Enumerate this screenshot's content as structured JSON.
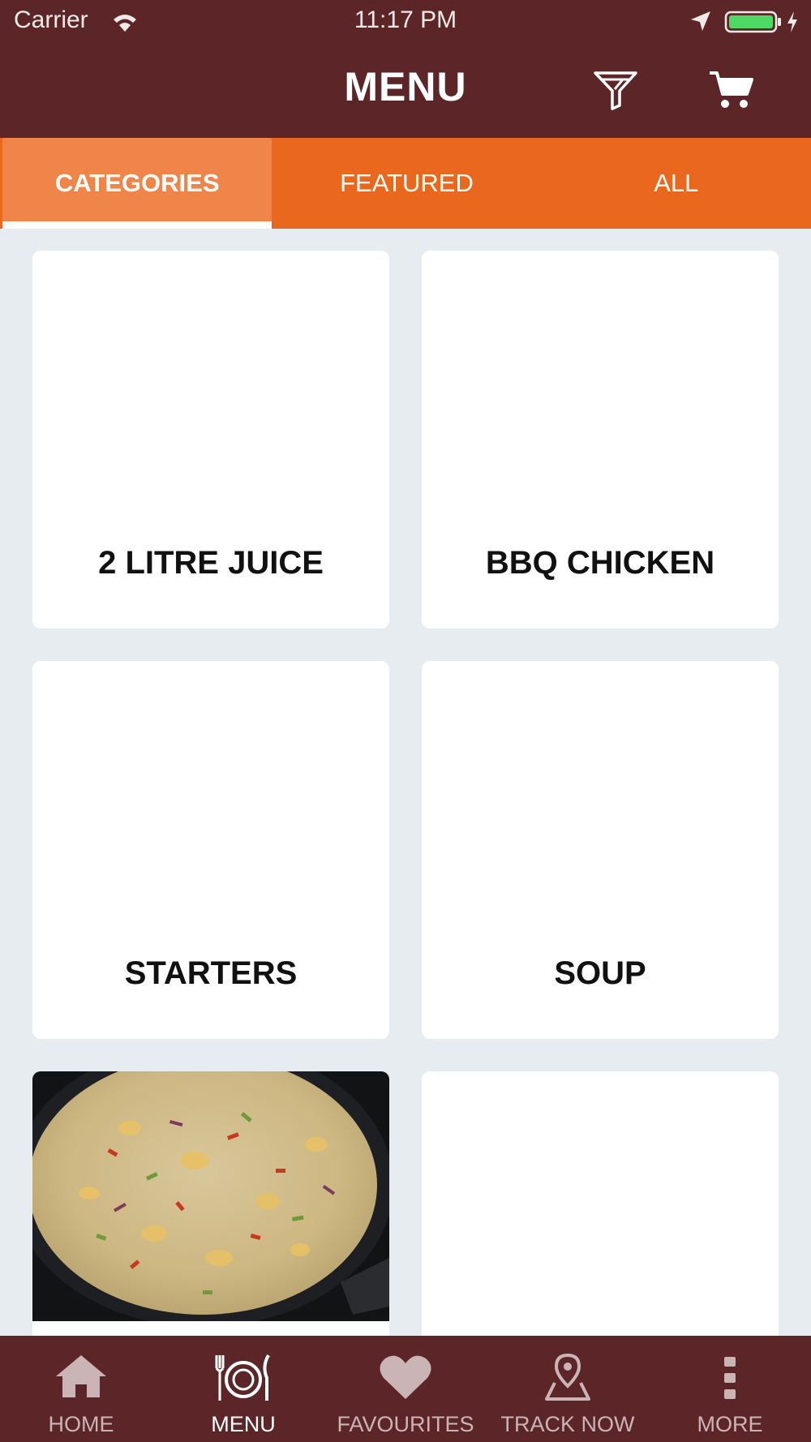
{
  "status_bar": {
    "carrier": "Carrier",
    "time": "11:17 PM"
  },
  "header": {
    "title": "MENU",
    "filter_icon": "filter-icon",
    "cart_icon": "cart-icon"
  },
  "tabs": [
    {
      "label": "CATEGORIES",
      "active": true
    },
    {
      "label": "FEATURED",
      "active": false
    },
    {
      "label": "ALL",
      "active": false
    }
  ],
  "categories": [
    {
      "name": "2 LITRE JUICE"
    },
    {
      "name": "BBQ CHICKEN"
    },
    {
      "name": "STARTERS"
    },
    {
      "name": "SOUP"
    },
    {
      "name": "",
      "image": "fried-rice-photo"
    },
    {
      "name": ""
    }
  ],
  "bottom_nav": [
    {
      "label": "HOME",
      "icon": "home-icon"
    },
    {
      "label": "MENU",
      "icon": "plate-cutlery-icon",
      "active": true
    },
    {
      "label": "FAVOURITES",
      "icon": "heart-icon"
    },
    {
      "label": "TRACK NOW",
      "icon": "map-pin-icon"
    },
    {
      "label": "MORE",
      "icon": "more-vertical-icon"
    }
  ],
  "colors": {
    "header_bg": "#5c2629",
    "tab_bar": "#ea681e",
    "active_tab": "#f0854a",
    "page_bg": "#e7ecf0"
  }
}
